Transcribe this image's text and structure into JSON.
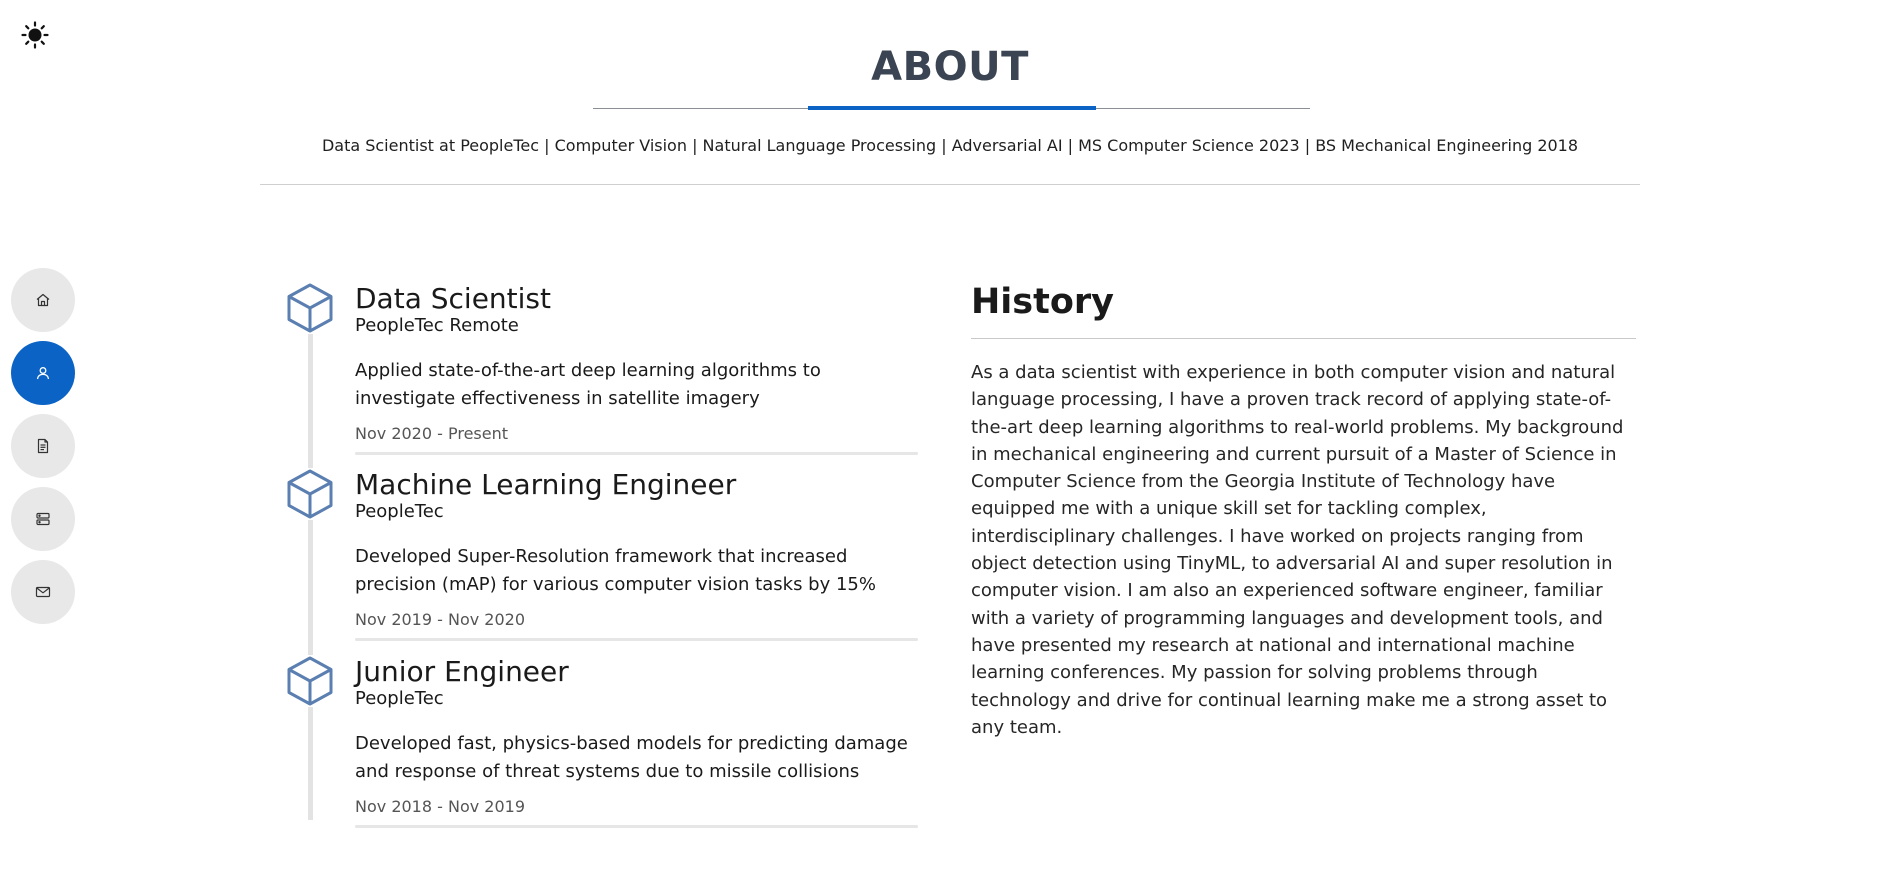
{
  "header": {
    "title": "ABOUT",
    "subtitle": "Data Scientist at PeopleTec | Computer Vision | Natural Language Processing | Adversarial AI | MS Computer Science 2023 | BS Mechanical Engineering 2018"
  },
  "theme_toggle": {
    "icon": "sun-icon"
  },
  "nav": {
    "items": [
      {
        "name": "home",
        "icon": "home-icon",
        "active": false
      },
      {
        "name": "about",
        "icon": "user-icon",
        "active": true
      },
      {
        "name": "resume",
        "icon": "document-icon",
        "active": false
      },
      {
        "name": "projects",
        "icon": "server-icon",
        "active": false
      },
      {
        "name": "contact",
        "icon": "mail-icon",
        "active": false
      }
    ]
  },
  "experience": [
    {
      "title": "Data Scientist",
      "company": "PeopleTec Remote",
      "description": "Applied state-of-the-art deep learning algorithms to investigate effectiveness in satellite imagery",
      "dates": "Nov 2020 - Present",
      "icon": "cube-icon"
    },
    {
      "title": "Machine Learning Engineer",
      "company": "PeopleTec",
      "description": "Developed Super-Resolution framework that increased precision (mAP) for various computer vision tasks by 15%",
      "dates": "Nov 2019 - Nov 2020",
      "icon": "cube-icon"
    },
    {
      "title": "Junior Engineer",
      "company": "PeopleTec",
      "description": "Developed fast, physics-based models for predicting damage and response of threat systems due to missile collisions",
      "dates": "Nov 2018 - Nov 2019",
      "icon": "cube-icon"
    }
  ],
  "history": {
    "title": "History",
    "text": "As a data scientist with experience in both computer vision and natural language processing, I have a proven track record of applying state-of-the-art deep learning algorithms to real-world problems. My background in mechanical engineering and current pursuit of a Master of Science in Computer Science from the Georgia Institute of Technology have equipped me with a unique skill set for tackling complex, interdisciplinary challenges. I have worked on projects ranging from object detection using TinyML, to adversarial AI and super resolution in computer vision. I am also an experienced software engineer, familiar with a variety of programming languages and development tools, and have presented my research at national and international machine learning conferences. My passion for solving problems through technology and drive for continual learning make me a strong asset to any team."
  },
  "colors": {
    "accent": "#0b63c5",
    "nav_inactive": "#e8e8e8",
    "cube_stroke": "#5a7fb0"
  }
}
